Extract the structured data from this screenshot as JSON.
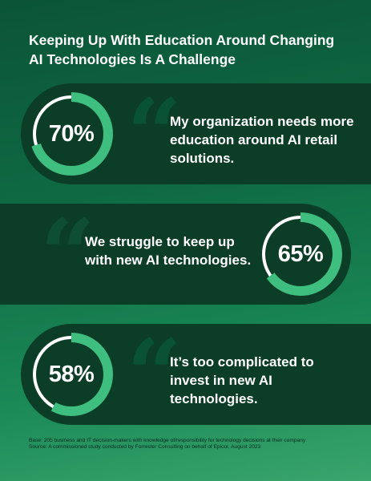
{
  "title": "Keeping Up With Education Around Changing AI Technologies Is A Challenge",
  "colors": {
    "ring_fill": "#3fbf7f",
    "ring_track": "#ffffff",
    "band": "#0b3d27",
    "quote": "#0a5234"
  },
  "chart_data": [
    {
      "type": "pie",
      "values": [
        70
      ],
      "label": "70%",
      "caption": "My organization needs more education around AI retail solutions."
    },
    {
      "type": "pie",
      "values": [
        65
      ],
      "label": "65%",
      "caption": "We struggle to keep up with new AI technologies."
    },
    {
      "type": "pie",
      "values": [
        58
      ],
      "label": "58%",
      "caption": "It’s too complicated to invest in new AI technologies."
    }
  ],
  "footer": {
    "base": "Base: 205 business and IT decision-makers with knowledge of/responsibility for technology decisions at their company",
    "source": "Source: A commissioned study conducted by Forrester Consulting on behalf of Epicor, August 2023"
  }
}
